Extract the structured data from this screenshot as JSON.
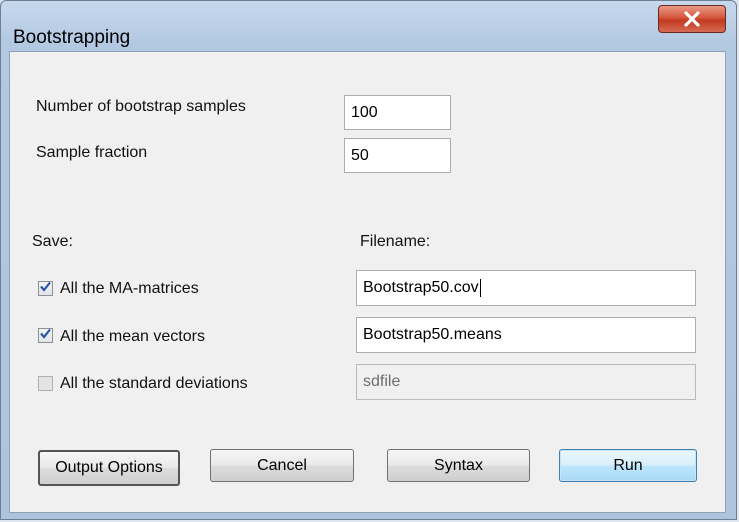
{
  "window": {
    "title": "Bootstrapping",
    "close_icon": "close-x-icon"
  },
  "params": {
    "num_samples_label": "Number of bootstrap samples",
    "num_samples_value": "100",
    "fraction_label": "Sample fraction",
    "fraction_value": "50"
  },
  "save": {
    "save_header": "Save:",
    "filename_header": "Filename:",
    "items": [
      {
        "label": "All the MA-matrices",
        "checked": true,
        "filename": "Bootstrap50.cov",
        "enabled": true
      },
      {
        "label": "All the mean vectors",
        "checked": true,
        "filename": "Bootstrap50.means",
        "enabled": true
      },
      {
        "label": "All the standard deviations",
        "checked": false,
        "filename": "sdfile",
        "enabled": false
      }
    ]
  },
  "buttons": {
    "output_options": "Output Options",
    "cancel": "Cancel",
    "syntax": "Syntax",
    "run": "Run"
  },
  "colors": {
    "close_button": "#c9452c",
    "checkmark": "#2a55a8",
    "default_button": "#bee6fd"
  }
}
